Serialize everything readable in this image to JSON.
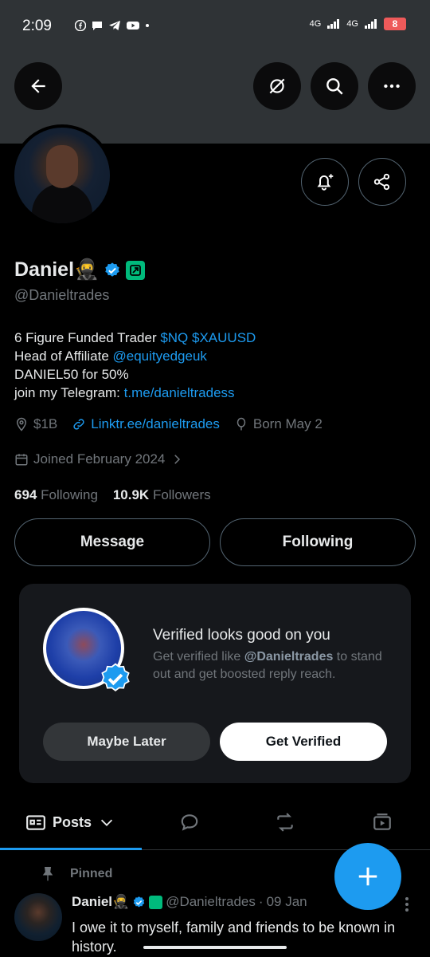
{
  "status_bar": {
    "time": "2:09",
    "net1": "4G",
    "net2": "4G",
    "battery": "8"
  },
  "colors": {
    "accent": "#1d9bf0",
    "background": "#000000",
    "banner": "#2f3336",
    "green_badge": "#00ba7c"
  },
  "icons": {
    "back": "arrow-left-icon",
    "grok": "grok-icon",
    "search": "search-icon",
    "more": "more-horizontal-icon",
    "notify": "bell-plus-icon",
    "share": "share-icon"
  },
  "profile": {
    "name": "Daniel🥷",
    "handle": "@Danieltrades",
    "bio": {
      "line1_text": "6 Figure Funded Trader ",
      "line1_link": "$NQ $XAUUSD",
      "line2_text": "Head of Affiliate ",
      "line2_link": "@equityedgeuk",
      "line3": "DANIEL50 for 50%",
      "line4_text": "join my Telegram: ",
      "line4_link": "t.me/danieltradess"
    },
    "location": "$1B",
    "website": "Linktr.ee/danieltrades",
    "born": "Born May 2",
    "joined": "Joined February 2024",
    "following_count": "694",
    "following_label": "Following",
    "followers_count": "10.9K",
    "followers_label": "Followers"
  },
  "actions": {
    "message": "Message",
    "following": "Following"
  },
  "verify_card": {
    "title": "Verified looks good on you",
    "sub_prefix": "Get verified like ",
    "sub_handle": "@Danieltrades",
    "sub_suffix": " to stand out and get boosted reply reach.",
    "maybe_later": "Maybe Later",
    "get_verified": "Get Verified"
  },
  "tabs": {
    "posts": "Posts"
  },
  "tweet": {
    "pinned_label": "Pinned",
    "name": "Daniel🥷",
    "handle": "@Danieltrades",
    "separator": "·",
    "date": "09 Jan",
    "text": "I owe it to myself, family and friends to be known in history."
  }
}
